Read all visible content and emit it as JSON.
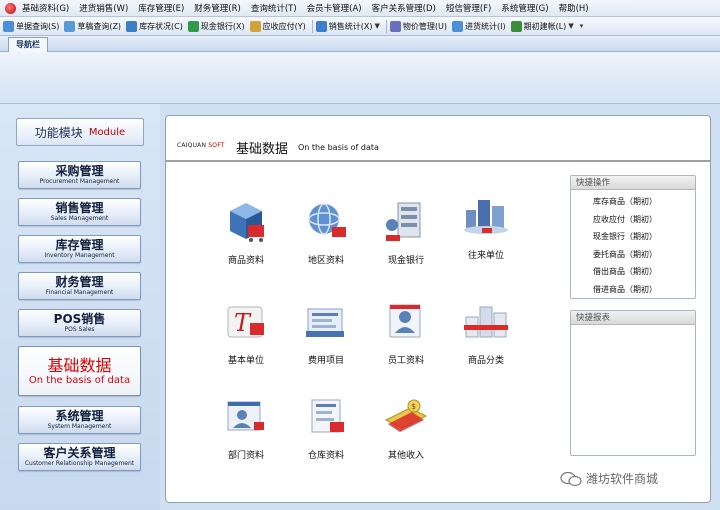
{
  "menu": [
    "基础资料(G)",
    "进货销售(W)",
    "库存管理(E)",
    "财务管理(R)",
    "查询统计(T)",
    "会员卡管理(A)",
    "客户关系管理(D)",
    "短信管理(F)",
    "系统管理(G)",
    "帮助(H)"
  ],
  "toolbar": [
    {
      "label": "单据查询(S)",
      "color": "#4a8fd8",
      "dropdown": false
    },
    {
      "label": "草稿查询(Z)",
      "color": "#5a9ad6",
      "dropdown": false
    },
    {
      "label": "库存状况(C)",
      "color": "#3c7fc4",
      "dropdown": false
    },
    {
      "label": "现金银行(X)",
      "color": "#2f9b4a",
      "dropdown": false
    },
    {
      "label": "应收应付(Y)",
      "color": "#d3a23a",
      "dropdown": false
    },
    {
      "label": "销售统计(X)",
      "color": "#3e7dc7",
      "dropdown": true
    },
    {
      "label": "物价管理(U)",
      "color": "#6a6fbf",
      "dropdown": false
    },
    {
      "label": "进货统计(I)",
      "color": "#4a8fd8",
      "dropdown": false
    },
    {
      "label": "期初建帐(L)",
      "color": "#3b8d3b",
      "dropdown": true
    }
  ],
  "nav": {
    "tab_label": "导航栏"
  },
  "left": {
    "header_cn": "功能模块",
    "header_en": "Module",
    "modules": [
      {
        "cn": "采购管理",
        "en": "Procurement Management",
        "active": false
      },
      {
        "cn": "销售管理",
        "en": "Sales Management",
        "active": false
      },
      {
        "cn": "库存管理",
        "en": "Inventory Management",
        "active": false
      },
      {
        "cn": "财务管理",
        "en": "Financial Management",
        "active": false
      },
      {
        "cn": "POS销售",
        "en": "POS Sales",
        "active": false
      },
      {
        "cn": "基础数据",
        "en": "On the basis of data",
        "active": true
      },
      {
        "cn": "系统管理",
        "en": "System Management",
        "active": false
      },
      {
        "cn": "客户关系管理",
        "en": "Customer Relationship Management",
        "active": false
      }
    ]
  },
  "main": {
    "brand_name": "CAIQUAN",
    "brand_soft": "SOFT",
    "title_cn": "基础数据",
    "title_en": "On the basis of data",
    "tiles": [
      {
        "label": "商品资料",
        "icon": "product-cube-icon"
      },
      {
        "label": "地区资料",
        "icon": "globe-icon"
      },
      {
        "label": "现金银行",
        "icon": "bank-building-icon"
      },
      {
        "label": "往来单位",
        "icon": "city-buildings-icon"
      },
      {
        "label": "基本单位",
        "icon": "unit-letter-icon"
      },
      {
        "label": "费用项目",
        "icon": "expense-document-icon"
      },
      {
        "label": "员工资料",
        "icon": "employee-card-icon"
      },
      {
        "label": "商品分类",
        "icon": "category-buildings-icon"
      },
      {
        "label": "部门资料",
        "icon": "department-card-icon"
      },
      {
        "label": "仓库资料",
        "icon": "warehouse-document-icon"
      },
      {
        "label": "其他收入",
        "icon": "money-icon"
      }
    ],
    "quick_ops": {
      "title": "快捷操作",
      "items": [
        "库存商品（期初）",
        "应收应付（期初）",
        "现金银行（期初）",
        "委托商品（期初）",
        "借出商品（期初）",
        "借进商品（期初）"
      ]
    },
    "quick_reports": {
      "title": "快捷报表"
    }
  },
  "watermark": {
    "text": "潍坊软件商城"
  }
}
